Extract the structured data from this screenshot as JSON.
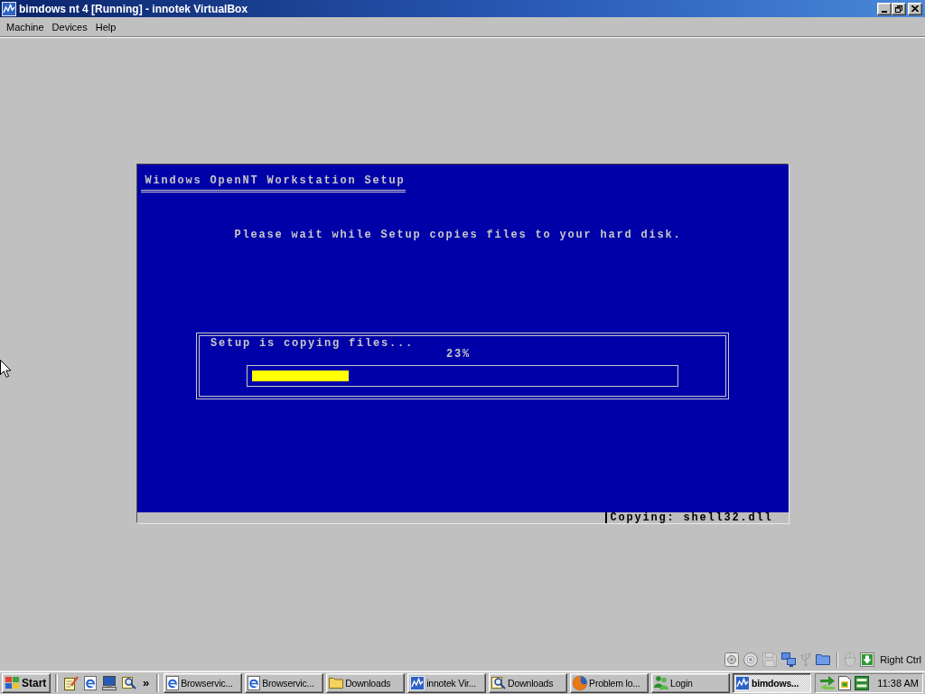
{
  "window": {
    "title": "bimdows nt 4 [Running] - innotek VirtualBox"
  },
  "menu": [
    "Machine",
    "Devices",
    "Help"
  ],
  "setup_screen": {
    "title": "Windows OpenNT Workstation Setup",
    "message": "Please wait while Setup copies files to your hard disk.",
    "progress": {
      "label": "Setup is copying files...",
      "percent": "23%",
      "level": 0.23
    },
    "status": "Copying: shell32.dll"
  },
  "vm_status_bar": {
    "device_indicators": [
      {
        "kind": "disk",
        "disabled": false
      },
      {
        "kind": "cd",
        "disabled": false
      },
      {
        "kind": "floppy",
        "disabled": true
      },
      {
        "kind": "network",
        "disabled": false
      },
      {
        "kind": "usb",
        "disabled": true
      },
      {
        "kind": "shared_folder",
        "disabled": false
      }
    ],
    "mode_indicators": [
      {
        "kind": "mouse",
        "disabled": true
      },
      {
        "kind": "host_key",
        "disabled": false
      }
    ],
    "host_key": "Right Ctrl"
  },
  "taskbar": {
    "start": "Start",
    "quick_launch": [
      {
        "kind": "notepad"
      },
      {
        "kind": "browser"
      },
      {
        "kind": "computer"
      },
      {
        "kind": "search"
      }
    ],
    "more": "»",
    "tasks": [
      {
        "label": "Browservic...",
        "kind": "browser",
        "selected": false
      },
      {
        "label": "Browservic...",
        "kind": "browser",
        "selected": false
      },
      {
        "label": "Downloads",
        "kind": "folder",
        "selected": false
      },
      {
        "label": "innotek Vir...",
        "kind": "vbox",
        "selected": false
      },
      {
        "label": "Downloads",
        "kind": "search",
        "selected": false
      },
      {
        "label": "Problem lo...",
        "kind": "globe",
        "selected": false
      },
      {
        "label": "Login",
        "kind": "people",
        "selected": false
      },
      {
        "label": "bimdows...",
        "kind": "vbox",
        "selected": true
      }
    ],
    "tray": [
      {
        "kind": "arrows"
      },
      {
        "kind": "document"
      },
      {
        "kind": "badge"
      }
    ],
    "clock": "11:38 AM"
  }
}
